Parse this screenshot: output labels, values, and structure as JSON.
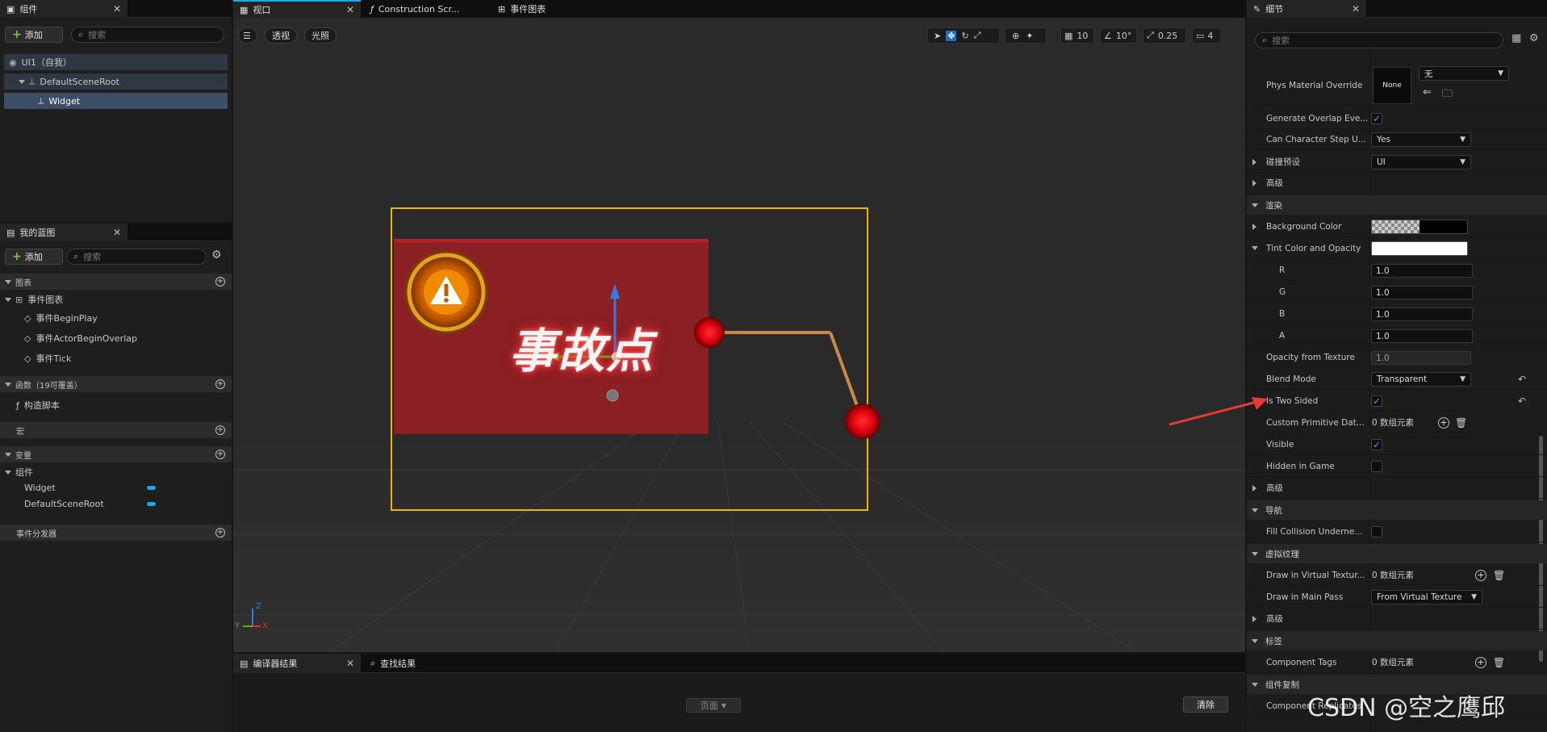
{
  "components_panel": {
    "tab_title": "组件",
    "add_label": "添加",
    "search_placeholder": "搜索",
    "tree": [
      {
        "label": "UI1（自我）"
      },
      {
        "label": "DefaultSceneRoot"
      },
      {
        "label": "Widget"
      }
    ]
  },
  "blueprint_panel": {
    "tab_title": "我的蓝图",
    "add_label": "添加",
    "search_placeholder": "搜索",
    "sections": {
      "graphs": "图表",
      "event_graph": "事件图表",
      "events": [
        "事件BeginPlay",
        "事件ActorBeginOverlap",
        "事件Tick"
      ],
      "functions": "函数（19可覆盖）",
      "construction": "构造脚本",
      "macros": "宏",
      "variables": "变量",
      "components": "组件",
      "component_vars": [
        "Widget",
        "DefaultSceneRoot"
      ],
      "dispatchers": "事件分发器"
    }
  },
  "center_tabs": [
    {
      "label": "视口"
    },
    {
      "label": "Construction Scr..."
    },
    {
      "label": "事件图表"
    }
  ],
  "viewport": {
    "perspective": "透视",
    "lighting": "光照",
    "grid_snap": "10",
    "rotation_snap": "10°",
    "scale_snap": "0.25",
    "camera_speed": "4",
    "widget_text": "事故点",
    "axis_y": "Y",
    "axis_z": "Z",
    "axis_x": "X"
  },
  "bottom_panel": {
    "tab_compiler": "编译器结果",
    "tab_find": "查找结果",
    "page_label": "页面",
    "clear_label": "清除"
  },
  "details": {
    "tab_title": "细节",
    "search_placeholder": "搜索",
    "rows": {
      "phys_material": "Phys Material Override",
      "phys_material_value": "None",
      "phys_material_combo": "无",
      "gen_overlap": "Generate Overlap Eve...",
      "can_step": "Can Character Step U...",
      "can_step_value": "Yes",
      "collision_preset": "碰撞预设",
      "collision_preset_value": "UI",
      "advanced": "高级",
      "render_section": "渲染",
      "bg_color": "Background Color",
      "tint": "Tint Color and Opacity",
      "r": "R",
      "r_val": "1.0",
      "g": "G",
      "g_val": "1.0",
      "b": "B",
      "b_val": "1.0",
      "a": "A",
      "a_val": "1.0",
      "opacity_tex": "Opacity from Texture",
      "opacity_tex_val": "1.0",
      "blend_mode": "Blend Mode",
      "blend_mode_val": "Transparent",
      "two_sided": "Is Two Sided",
      "custom_prim": "Custom Primitive Dat...",
      "array_empty": "0 数组元素",
      "visible": "Visible",
      "hidden_game": "Hidden in Game",
      "advanced2": "高级",
      "nav_section": "导航",
      "fill_collision": "Fill Collision Underne...",
      "vt_section": "虚拟纹理",
      "draw_vt": "Draw in Virtual Textur...",
      "draw_main": "Draw in Main Pass",
      "draw_main_val": "From Virtual Texture",
      "advanced3": "高级",
      "tags_section": "标签",
      "component_tags": "Component Tags",
      "replication_section": "组件复制",
      "component_replicates": "Component Replicates"
    }
  },
  "watermark": "CSDN @空之鹰邱",
  "colors": {
    "accent_blue": "#1fa7e8",
    "selection_outline": "#f0b400",
    "widget_red": "#8a1f24",
    "check_blue": "#3aa0ff",
    "arrow_red": "#e53935"
  }
}
